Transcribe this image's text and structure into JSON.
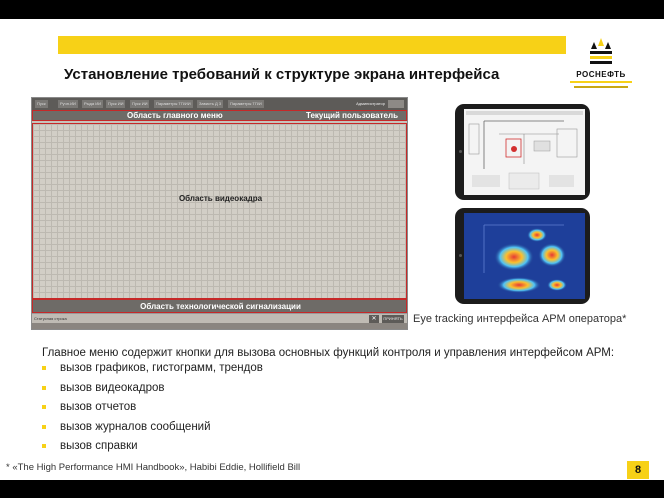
{
  "slide": {
    "title": "Установление требований к структуре экрана интерфейса",
    "logo": {
      "name": "РОСНЕФТЬ"
    },
    "hmi": {
      "tabs": [
        "Пуск",
        "Ручн.ИИ",
        "Рыда ИИ",
        "Пуск ИИ",
        "Пуск ИИ",
        "Параметры ТП/ИИ",
        "Зависть Д 3",
        "Параметры ТП/И"
      ],
      "user_chip": "Администратор",
      "main_menu_label": "Область главного меню",
      "current_user_label": "Текущий пользователь",
      "video_frame_label": "Область видеокадра",
      "alarm_area_label": "Область технологической сигнализации",
      "status_bar_label": "Статусная строка",
      "status_close": "✕",
      "status_button": "ПРИНЯТЬ"
    },
    "eye_tracking_caption": "Eye tracking интерфейса АРМ оператора*",
    "description": "Главное меню содержит кнопки для вызова основных функций контроля и управления интерфейсом АРМ:",
    "items": [
      "вызов графиков, гистограмм, трендов",
      "вызов видеокадров",
      "вызов отчетов",
      "вызов журналов сообщений",
      "вызов справки"
    ],
    "footnote": "* «The High Performance HMI Handbook», Habibi Eddie, Hollifield Bill",
    "page_number": "8"
  },
  "colors": {
    "accent": "#f7d117",
    "area_border": "#c62828",
    "hmi_dark": "#6e6b67"
  }
}
